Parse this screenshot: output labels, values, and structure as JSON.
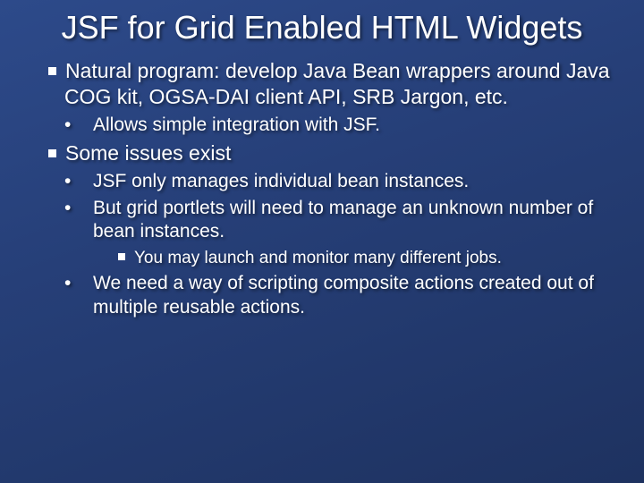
{
  "title": "JSF for Grid Enabled HTML Widgets",
  "body": {
    "b1": "Natural program: develop Java Bean wrappers around Java COG kit, OGSA-DAI client API, SRB Jargon, etc.",
    "b1_1": "Allows simple integration with JSF.",
    "b2": "Some issues exist",
    "b2_1": "JSF only manages individual bean instances.",
    "b2_2": "But grid portlets will need to manage an unknown number of bean instances.",
    "b2_2_1": "You may launch and monitor many different jobs.",
    "b2_3": "We need a way of scripting composite actions created out of multiple reusable actions."
  }
}
